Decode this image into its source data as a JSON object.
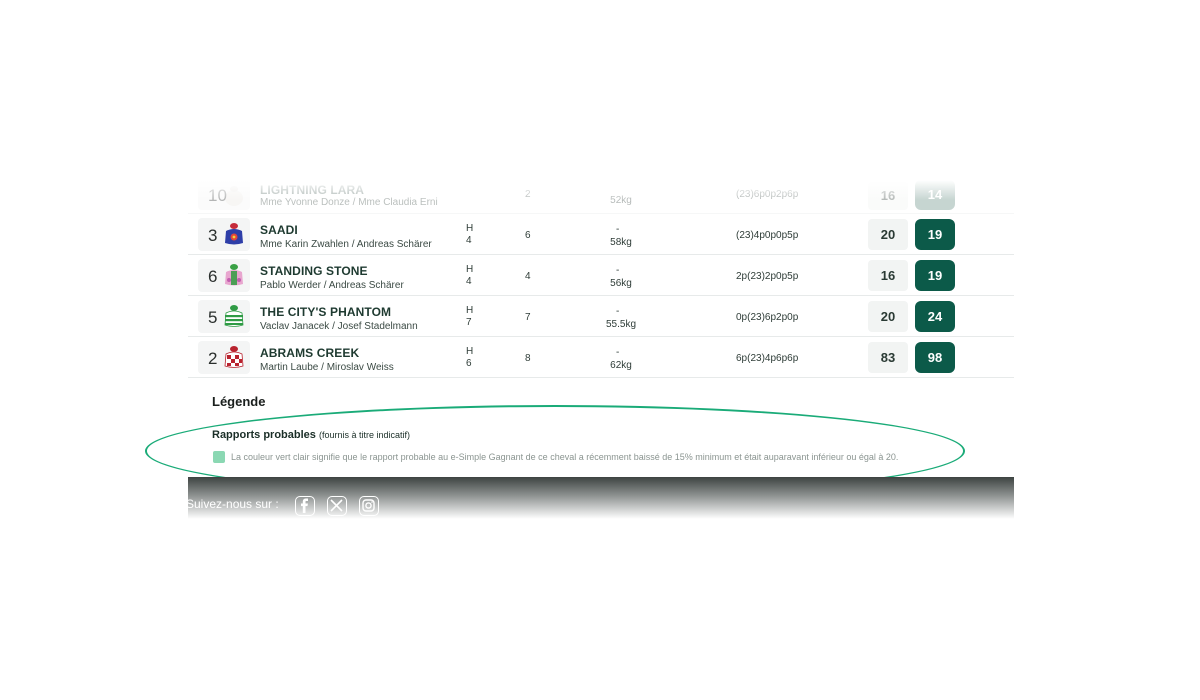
{
  "runners": [
    {
      "num": "10",
      "name": "LIGHTNING LARA",
      "people": "Mme Yvonne Donze / Mme Claudia Erni",
      "sex": "",
      "age": "",
      "runs": "2",
      "dash": "",
      "weight": "52kg",
      "music": "(23)6p0p2p6p",
      "odd1": "16",
      "odd2": "14",
      "silk": "white"
    },
    {
      "num": "3",
      "name": "SAADI",
      "people": "Mme Karin Zwahlen / Andreas Schärer",
      "sex": "H",
      "age": "4",
      "runs": "6",
      "dash": "-",
      "weight": "58kg",
      "music": "(23)4p0p0p5p",
      "odd1": "20",
      "odd2": "19",
      "silk": "blue"
    },
    {
      "num": "6",
      "name": "STANDING STONE",
      "people": "Pablo Werder / Andreas Schärer",
      "sex": "H",
      "age": "4",
      "runs": "4",
      "dash": "-",
      "weight": "56kg",
      "music": "2p(23)2p0p5p",
      "odd1": "16",
      "odd2": "19",
      "silk": "pink"
    },
    {
      "num": "5",
      "name": "THE CITY'S PHANTOM",
      "people": "Vaclav Janacek / Josef Stadelmann",
      "sex": "H",
      "age": "7",
      "runs": "7",
      "dash": "-",
      "weight": "55.5kg",
      "music": "0p(23)6p2p0p",
      "odd1": "20",
      "odd2": "24",
      "silk": "green"
    },
    {
      "num": "2",
      "name": "ABRAMS CREEK",
      "people": "Martin Laube / Miroslav Weiss",
      "sex": "H",
      "age": "6",
      "runs": "8",
      "dash": "-",
      "weight": "62kg",
      "music": "6p(23)4p6p6p",
      "odd1": "83",
      "odd2": "98",
      "silk": "red"
    }
  ],
  "legend": {
    "title": "Légende",
    "rapports_title": "Rapports probables",
    "rapports_note": "(fournis à titre indicatif)",
    "text": "La couleur vert clair signifie que le rapport probable au e-Simple Gagnant de ce cheval a récemment baissé de 15% minimum et était auparavant inférieur ou égal à 20.",
    "swatch_color": "#8bd8b3"
  },
  "footer": {
    "follow_label": "Suivez-nous sur :",
    "icons": [
      "facebook-icon",
      "x-icon",
      "instagram-icon"
    ]
  },
  "colors": {
    "accent": "#0c5a49",
    "highlight_ellipse": "#1aab78"
  }
}
